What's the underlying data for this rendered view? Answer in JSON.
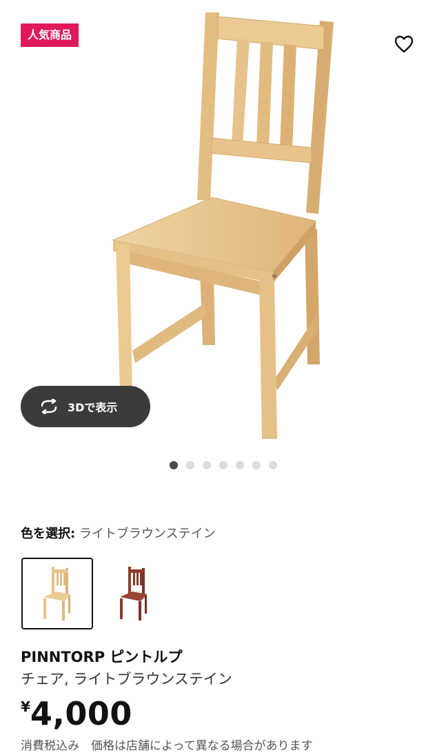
{
  "product": {
    "badge": "人気商品",
    "view_3d_label": "3Dで表示",
    "gallery_dots": 7,
    "active_dot": 0,
    "color_select_label": "色を選択:",
    "color_selected_value": "ライトブラウンステイン",
    "swatches": [
      {
        "name": "ライトブラウンステイン",
        "selected": true
      },
      {
        "name": "brown-red",
        "selected": false
      }
    ],
    "name": "PINNTORP ピントルプ",
    "description": "チェア, ライトブラウンステイン",
    "currency": "¥",
    "price": "4,000",
    "price_note": "消費税込み　価格は店舗によって異なる場合があります"
  },
  "icons": {
    "favorite": "heart-icon",
    "rotate": "rotate-icon"
  },
  "colors": {
    "badge": "#e0195a",
    "wood": "#e8c48c",
    "red_brown": "#8a3b2c",
    "button_dark": "#3b3b3b"
  }
}
